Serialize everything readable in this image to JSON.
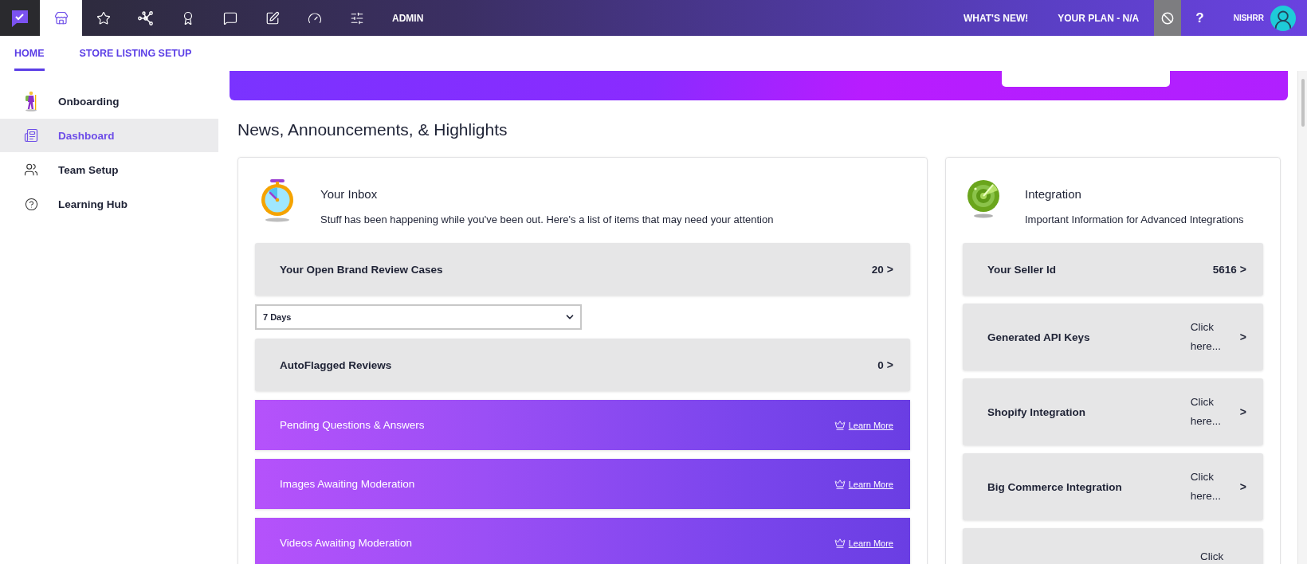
{
  "top_bar": {
    "nav_icons": [
      {
        "kind": "store",
        "selected": true
      },
      {
        "kind": "star",
        "selected": false
      },
      {
        "kind": "nodes",
        "selected": false
      },
      {
        "kind": "award",
        "selected": false
      },
      {
        "kind": "chat",
        "selected": false
      },
      {
        "kind": "chat-pen",
        "selected": false
      },
      {
        "kind": "gauge",
        "selected": false
      },
      {
        "kind": "sliders",
        "selected": false
      }
    ],
    "admin": "ADMIN",
    "whats_new": "WHAT'S NEW!",
    "plan": "YOUR PLAN - N/A",
    "help": "?",
    "user": "NISHRR"
  },
  "tabs": [
    {
      "label": "HOME",
      "selected": true
    },
    {
      "label": "STORE LISTING SETUP",
      "selected": false
    }
  ],
  "sidebar": {
    "items": [
      {
        "kind": "hiker",
        "label": "Onboarding",
        "selected": false
      },
      {
        "kind": "dashboard",
        "label": "Dashboard",
        "selected": true
      },
      {
        "kind": "team",
        "label": "Team Setup",
        "selected": false
      },
      {
        "kind": "help",
        "label": "Learning Hub",
        "selected": false
      }
    ]
  },
  "heading": "News, Announcements, & Highlights",
  "inbox": {
    "title": "Your Inbox",
    "description": "Stuff has been happening while you've been out. Here's a list of items that may need your attention",
    "items": [
      {
        "kind": "count",
        "label": "Your Open Brand Review Cases",
        "value": "20",
        "arrow": ">"
      },
      {
        "kind": "dropdown",
        "value": "7 Days"
      },
      {
        "kind": "count",
        "label": "AutoFlagged Reviews",
        "value": "0",
        "arrow": ">"
      },
      {
        "kind": "premium",
        "label": "Pending Questions & Answers",
        "link": "Learn More"
      },
      {
        "kind": "premium",
        "label": "Images Awaiting Moderation",
        "link": "Learn More"
      },
      {
        "kind": "premium",
        "label": "Videos Awaiting Moderation",
        "link": "Learn More"
      }
    ]
  },
  "integration": {
    "title": "Integration",
    "description": "Important Information for Advanced Integrations",
    "items": [
      {
        "kind": "value",
        "label": "Your Seller Id",
        "value": "5616",
        "arrow": ">"
      },
      {
        "kind": "link",
        "label": "Generated API Keys",
        "value": "Click here...",
        "arrow": ">"
      },
      {
        "kind": "link",
        "label": "Shopify Integration",
        "value": "Click here...",
        "arrow": ">"
      },
      {
        "kind": "link",
        "label": "Big Commerce Integration",
        "value": "Click here...",
        "arrow": ">"
      },
      {
        "kind": "link",
        "value": "Click"
      }
    ]
  }
}
